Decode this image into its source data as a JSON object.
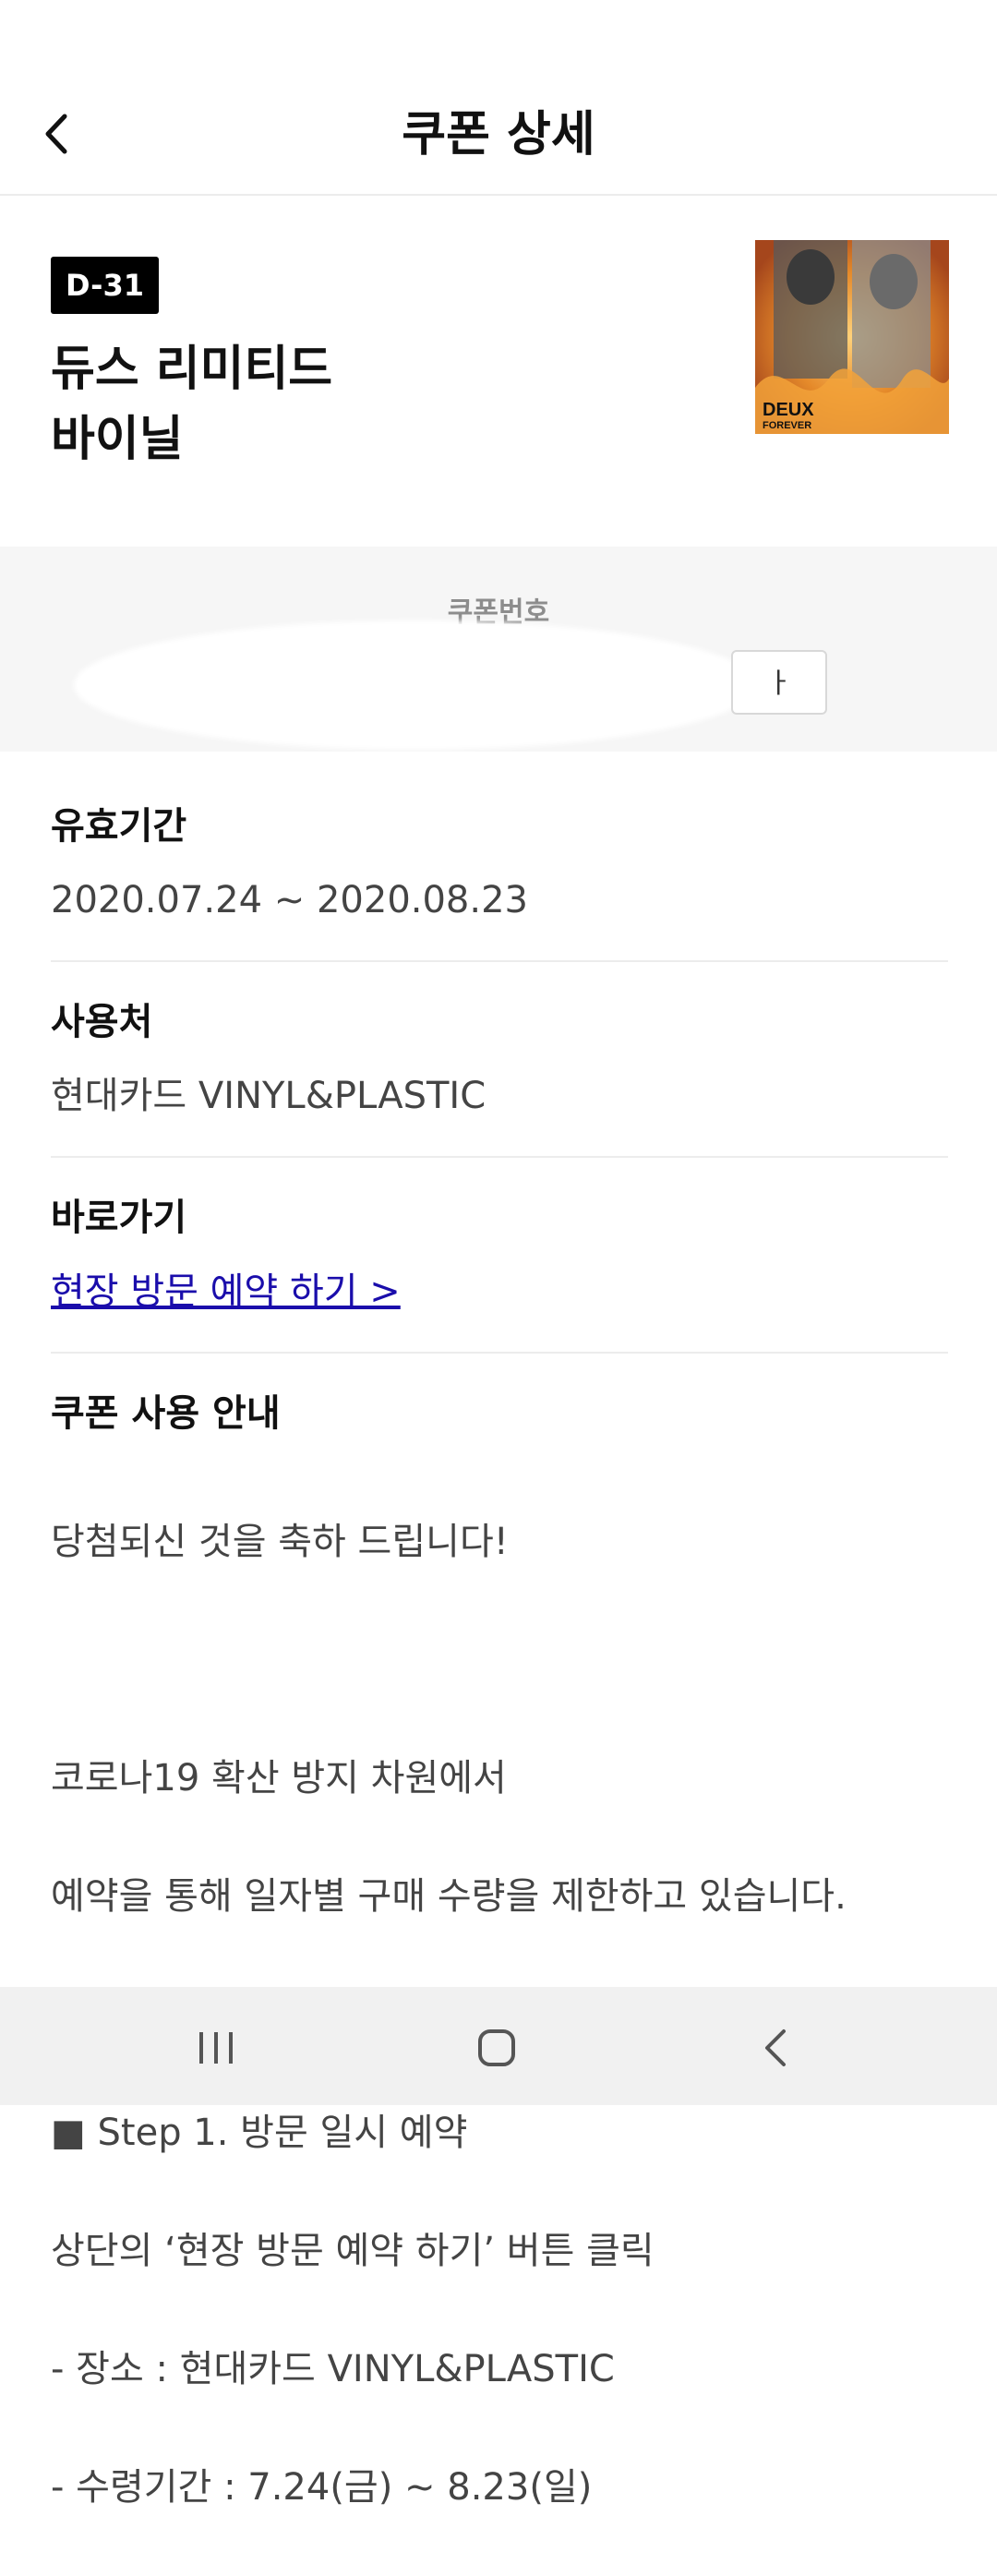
{
  "header": {
    "title": "쿠폰 상세"
  },
  "coupon": {
    "badge": "D-31",
    "name_line1": "듀스 리미티드",
    "name_line2": "바이닐",
    "album_text_1": "DEUX",
    "album_text_2": "FOREVER",
    "number_label": "쿠폰번호",
    "copy_label": "ㅏ"
  },
  "details": {
    "validity": {
      "title": "유효기간",
      "value": "2020.07.24 ~ 2020.08.23"
    },
    "place": {
      "title": "사용처",
      "value": "현대카드 VINYL&PLASTIC"
    },
    "shortcut": {
      "title": "바로가기",
      "link": "현장 방문 예약 하기 >"
    },
    "guide": {
      "title": "쿠폰 사용 안내",
      "lines": [
        "당첨되신 것을 축하 드립니다!",
        "",
        "코로나19 확산 방지 차원에서",
        "예약을 통해 일자별 구매 수량을 제한하고 있습니다.",
        "",
        "■ Step 1. 방문 일시 예약",
        "상단의 ‘현장 방문 예약 하기’ 버튼 클릭",
        "- 장소 : 현대카드 VINYL&PLASTIC",
        "- 수령기간 : 7.24(금) ~ 8.23(일)"
      ]
    }
  },
  "icons": {
    "back": "chevron-left-icon",
    "recents": "recent-apps-icon",
    "home": "home-icon",
    "nav_back": "nav-back-icon"
  }
}
